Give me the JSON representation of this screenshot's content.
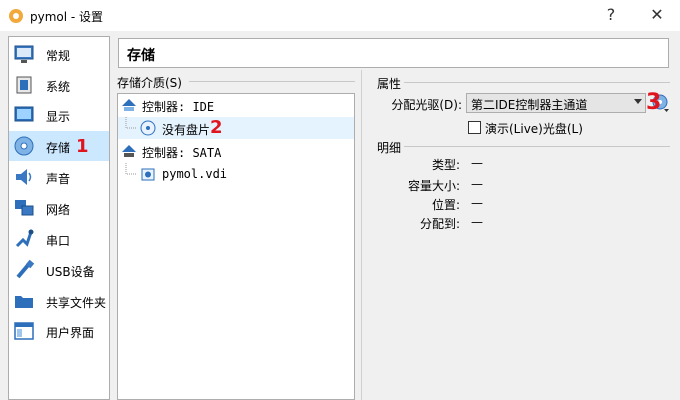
{
  "window": {
    "title": "pymol - 设置",
    "help": "?",
    "close": "✕"
  },
  "sidebar": {
    "items": [
      {
        "label": "常规"
      },
      {
        "label": "系统"
      },
      {
        "label": "显示"
      },
      {
        "label": "存储"
      },
      {
        "label": "声音"
      },
      {
        "label": "网络"
      },
      {
        "label": "串口"
      },
      {
        "label": "USB设备"
      },
      {
        "label": "共享文件夹"
      },
      {
        "label": "用户界面"
      }
    ],
    "selected": "存储"
  },
  "page": {
    "title": "存储"
  },
  "storage_tree": {
    "title": "存储介质(S)",
    "rows": [
      {
        "label": "控制器: IDE"
      },
      {
        "label": "没有盘片"
      },
      {
        "label": "控制器: SATA"
      },
      {
        "label": "pymol.vdi"
      }
    ]
  },
  "attributes": {
    "title": "属性",
    "drive_label": "分配光驱(D):",
    "drive_value": "第二IDE控制器主通道",
    "live_cd_label": "演示(Live)光盘(L)"
  },
  "details": {
    "title": "明细",
    "rows": [
      {
        "label": "类型:",
        "value": "—"
      },
      {
        "label": "容量大小:",
        "value": "—"
      },
      {
        "label": "位置:",
        "value": "—"
      },
      {
        "label": "分配到:",
        "value": "—"
      }
    ]
  },
  "annotations": {
    "mark1": "1",
    "mark2": "2",
    "mark3": "3"
  },
  "colors": {
    "selection": "#cce8ff",
    "annotation": "#e0141e"
  }
}
